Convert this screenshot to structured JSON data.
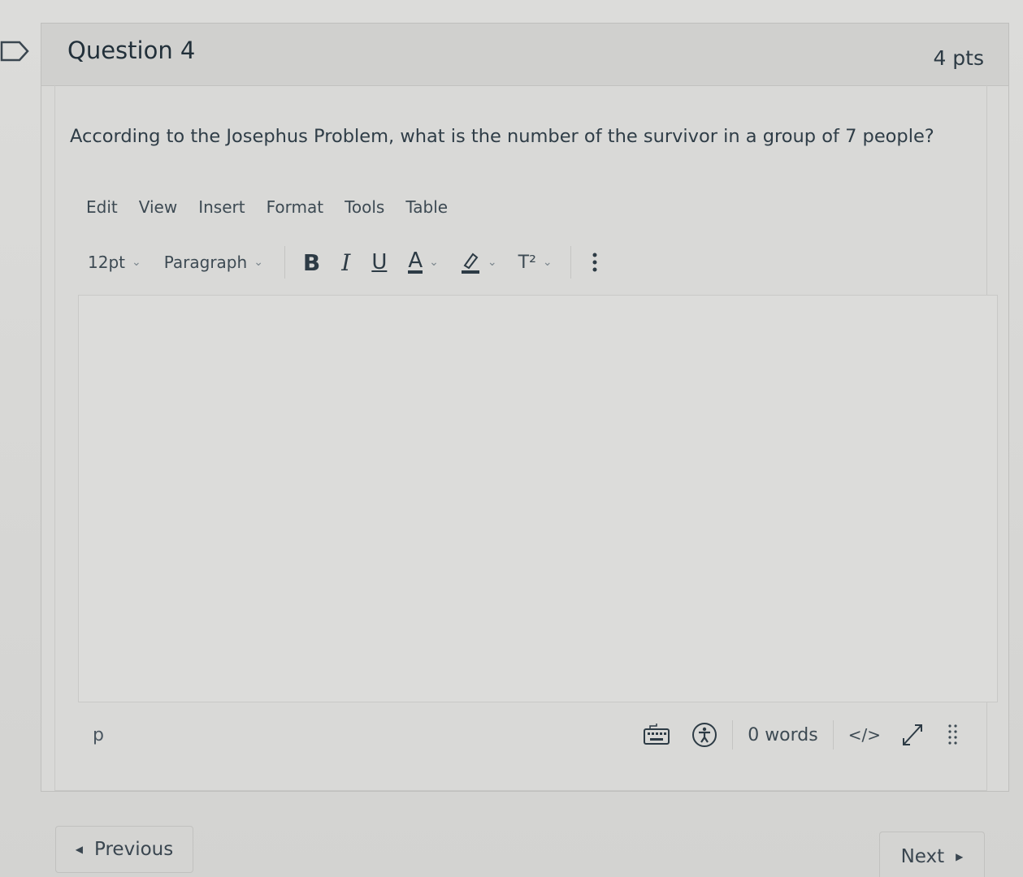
{
  "question": {
    "title": "Question 4",
    "points": "4 pts",
    "text": "According to the Josephus Problem, what is the number of the survivor in a group of 7 people?"
  },
  "menubar": {
    "items": [
      "Edit",
      "View",
      "Insert",
      "Format",
      "Tools",
      "Table"
    ]
  },
  "toolbar": {
    "font_size": "12pt",
    "block_format": "Paragraph",
    "bold": "B",
    "italic": "I",
    "underline": "U",
    "text_color": "A",
    "superscript": "T²"
  },
  "statusbar": {
    "path": "p",
    "word_count": "0 words",
    "html_toggle": "</>"
  },
  "navigation": {
    "previous_label": "Previous",
    "next_label": "Next"
  },
  "icons": {
    "flag": "flag-outline-icon",
    "dropdown": "chevron-down-icon",
    "highlight": "highlighter-icon",
    "more": "more-vertical-icon",
    "keyboard": "keyboard-icon",
    "accessibility": "accessibility-icon",
    "fullscreen": "expand-icon",
    "resize": "resize-grip-icon"
  }
}
